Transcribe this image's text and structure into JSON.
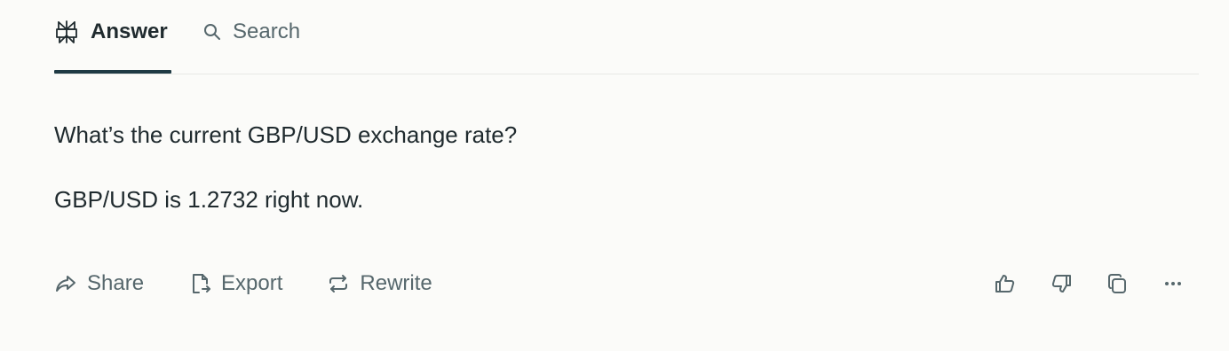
{
  "tabs": {
    "answer_label": "Answer",
    "search_label": "Search",
    "active": "Answer"
  },
  "conversation": {
    "question": "What’s the current GBP/USD exchange rate?",
    "answer": "GBP/USD is 1.2732 right now."
  },
  "actions": {
    "share_label": "Share",
    "export_label": "Export",
    "rewrite_label": "Rewrite"
  },
  "icons": {
    "answer": "perplexity-logo-icon",
    "search": "search-icon",
    "share": "share-arrow-icon",
    "export": "export-file-icon",
    "rewrite": "rewrite-icon",
    "like": "thumbs-up-icon",
    "dislike": "thumbs-down-icon",
    "copy": "copy-icon",
    "more": "more-options-icon"
  },
  "colors": {
    "background": "#fbfbf9",
    "text": "#1f2a2e",
    "muted": "#56676c",
    "accent": "#1f3a44"
  }
}
